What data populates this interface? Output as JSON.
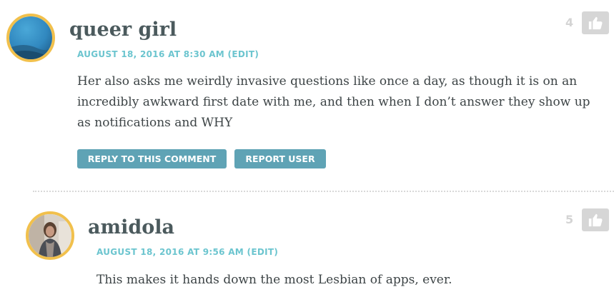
{
  "comments": [
    {
      "author": "queer girl",
      "date": "AUGUST 18, 2016 AT 8:30 AM",
      "edit_label": "(EDIT)",
      "body_lines": [
        "Her also asks me weirdly invasive questions like once a day, as though it is on an",
        "incredibly awkward first date with me, and then when I don’t answer they show up",
        "as notifications and WHY"
      ],
      "reply_label": "REPLY TO THIS COMMENT",
      "report_label": "REPORT USER",
      "like_count": "4",
      "like_icon": "thumbs-up-icon"
    },
    {
      "author": "amidola",
      "date": "AUGUST 18, 2016 AT 9:56 AM",
      "edit_label": "(EDIT)",
      "body_lines": [
        "This makes it hands down the most Lesbian of apps, ever."
      ],
      "like_count": "5",
      "like_icon": "thumbs-up-icon"
    }
  ],
  "colors": {
    "avatar_ring": "#f1c04c",
    "meta_text": "#6cc5cf",
    "button_bg": "#5fa3b5",
    "like_bg": "#d6d6d6",
    "author_text": "#4b5a5d"
  }
}
